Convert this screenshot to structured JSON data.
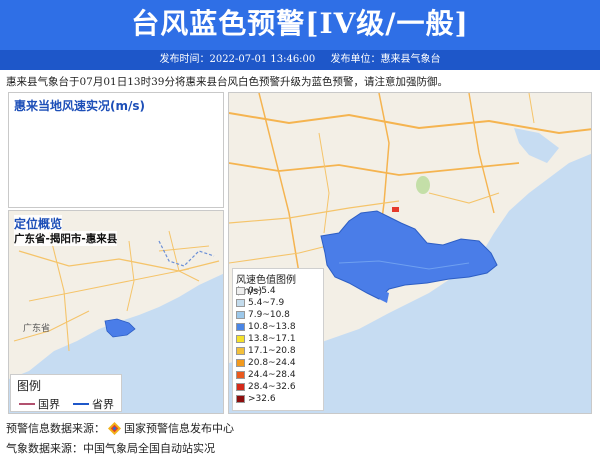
{
  "header": {
    "title": "台风蓝色预警[IV级/一般]",
    "publish_time": "发布时间：2022-07-01 13:46:00",
    "publisher": "发布单位：惠来县气象台"
  },
  "message": "惠来县气象台于07月01日13时39分将惠来县台风白色预警升级为蓝色预警，请注意加强防御。",
  "wind_panel": {
    "title": "惠来当地风速实况(m/s)"
  },
  "location_panel": {
    "title": "定位概览",
    "subtitle": "广东省-揭阳市-惠来县"
  },
  "map_labels": {
    "guangdong": "广东省"
  },
  "mini_legend": {
    "title": "图例",
    "national_border": "国界",
    "provincial_border": "省界"
  },
  "wind_legend": {
    "title": "风速色值图例 (m/s)",
    "items": [
      {
        "label": "0~5.4",
        "color": "#eeeeee"
      },
      {
        "label": "5.4~7.9",
        "color": "#c3dbec"
      },
      {
        "label": "7.9~10.8",
        "color": "#9cc8ea"
      },
      {
        "label": "10.8~13.8",
        "color": "#4a86e6"
      },
      {
        "label": "13.8~17.1",
        "color": "#f5e12a"
      },
      {
        "label": "17.1~20.8",
        "color": "#f3c03a"
      },
      {
        "label": "20.8~24.4",
        "color": "#f29a1e"
      },
      {
        "label": "24.4~28.4",
        "color": "#ea5a1e"
      },
      {
        "label": "28.4~32.6",
        "color": "#d42a1a"
      },
      {
        "label": ">32.6",
        "color": "#8d0e0e"
      }
    ]
  },
  "footer": {
    "warning_source_label": "预警信息数据来源：",
    "warning_source": "国家预警信息发布中心",
    "weather_source": "气象数据来源：中国气象局全国自动站实况"
  },
  "colors": {
    "header_blue": "#2f6fe6",
    "meta_blue": "#1e57c9",
    "region_blue": "#4a7de8",
    "sea": "#c6dcf2"
  }
}
